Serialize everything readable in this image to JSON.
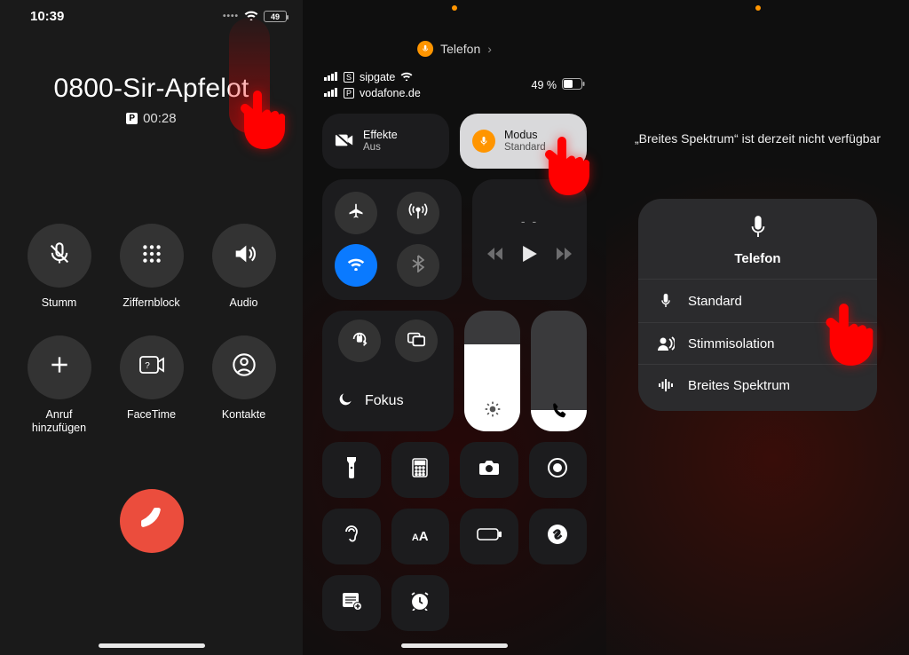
{
  "screen1": {
    "time": "10:39",
    "battery_pct": "49",
    "caller_name": "0800-Sir-Apfelot",
    "duration": "00:28",
    "badge": "P",
    "buttons": {
      "mute": "Stumm",
      "keypad": "Ziffernblock",
      "audio": "Audio",
      "add_call": "Anruf\nhinzufügen",
      "facetime": "FaceTime",
      "contacts": "Kontakte"
    }
  },
  "screen2": {
    "app_label": "Telefon",
    "carrier1": "sipgate",
    "carrier1_badge": "S",
    "carrier2": "vodafone.de",
    "carrier2_badge": "P",
    "battery_label": "49 %",
    "effects_label": "Effekte",
    "effects_sub": "Aus",
    "mode_label": "Modus",
    "mode_sub": "Standard",
    "media_placeholder": "- -",
    "focus_label": "Fokus"
  },
  "screen3": {
    "toast": "„Breites Spektrum“ ist derzeit nicht verfügbar",
    "panel_title": "Telefon",
    "options": {
      "standard": "Standard",
      "voice_iso": "Stimmisolation",
      "wide": "Breites Spektrum"
    }
  }
}
